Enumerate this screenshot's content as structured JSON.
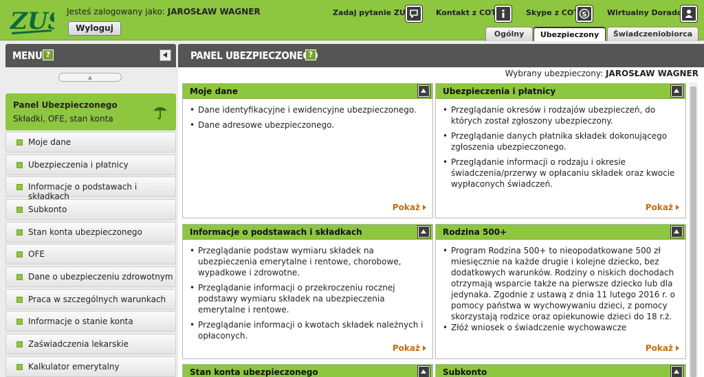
{
  "header": {
    "logo_text": "ZUS",
    "logged_in_prefix": "Jesteś zalogowany jako:",
    "user_name": "JAROSŁAW WAGNER",
    "logout_label": "Wyloguj",
    "links": [
      {
        "label": "Zadaj pytanie ZUS",
        "icon": "chat-icon"
      },
      {
        "label": "Kontakt z COT",
        "icon": "info-icon"
      },
      {
        "label": "Skype z COT",
        "icon": "skype-icon"
      },
      {
        "label": "Wirtualny Doradca",
        "icon": "user-icon"
      }
    ],
    "tabs": [
      {
        "label": "Ogólny",
        "active": false
      },
      {
        "label": "Ubezpieczony",
        "active": true
      },
      {
        "label": "Świadczeniobiorca",
        "active": false
      }
    ]
  },
  "sidebar": {
    "title": "MENU",
    "help_label": "?",
    "panel": {
      "title": "Panel Ubezpieczonego",
      "subtitle": "Składki, OFE, stan konta"
    },
    "items": [
      {
        "label": "Moje dane"
      },
      {
        "label": "Ubezpieczenia i płatnicy"
      },
      {
        "label": "Informacje o podstawach i składkach"
      },
      {
        "label": "Subkonto"
      },
      {
        "label": "Stan konta ubezpieczonego"
      },
      {
        "label": "OFE"
      },
      {
        "label": "Dane o ubezpieczeniu zdrowotnym"
      },
      {
        "label": "Praca w szczególnych warunkach"
      },
      {
        "label": "Informacje o stanie konta"
      },
      {
        "label": "Zaświadczenia lekarskie"
      },
      {
        "label": "Kalkulator emerytalny"
      }
    ]
  },
  "main": {
    "title": "PANEL UBEZPIECZONEGO",
    "help_label": "?",
    "selected_prefix": "Wybrany ubezpieczony:",
    "selected_name": "JAROSŁAW WAGNER",
    "show_label": "Pokaż",
    "cards": [
      {
        "title": "Moje dane",
        "items": [
          "Dane identyfikacyjne i ewidencyjne ubezpieczonego.",
          "Dane adresowe ubezpieczonego."
        ]
      },
      {
        "title": "Ubezpieczenia i płatnicy",
        "items": [
          "Przeglądanie okresów i rodzajów ubezpieczeń, do których został zgłoszony ubezpieczony.",
          "Przeglądanie danych płatnika składek dokonującego zgłoszenia ubezpieczonego.",
          "Przeglądanie informacji o rodzaju i okresie świadczenia/przerwy w opłacaniu składek oraz kwocie wypłaconych świadczeń."
        ]
      },
      {
        "title": "Informacje o podstawach i składkach",
        "items": [
          "Przeglądanie podstaw wymiaru składek na ubezpieczenia emerytalne i rentowe, chorobowe, wypadkowe i zdrowotne.",
          "Przeglądanie informacji o przekroczeniu rocznej podstawy wymiaru składek na ubezpieczenia emerytalne i rentowe.",
          "Przeglądanie informacji o kwotach składek należnych i opłaconych."
        ]
      },
      {
        "title": "Rodzina 500+",
        "items": [
          "Program Rodzina 500+ to nieopodatkowane 500 zł miesięcznie na każde drugie i kolejne dziecko, bez dodatkowych warunków. Rodziny o niskich dochodach otrzymają wsparcie także na pierwsze dziecko lub dla jedynaka. Zgodnie z ustawą z dnia 11 lutego 2016 r. o pomocy państwa w wychowywaniu dzieci, z pomocy skorzystają rodzice oraz opiekunowie dzieci do 18 r.ż.",
          "Złóż wniosek o świadczenie wychowawcze"
        ]
      },
      {
        "title": "Stan konta ubezpieczonego"
      },
      {
        "title": "Subkonto"
      }
    ]
  },
  "colors": {
    "brand_green": "#8dc63f",
    "dark_bar": "#555555",
    "link_orange": "#c86b0f"
  }
}
